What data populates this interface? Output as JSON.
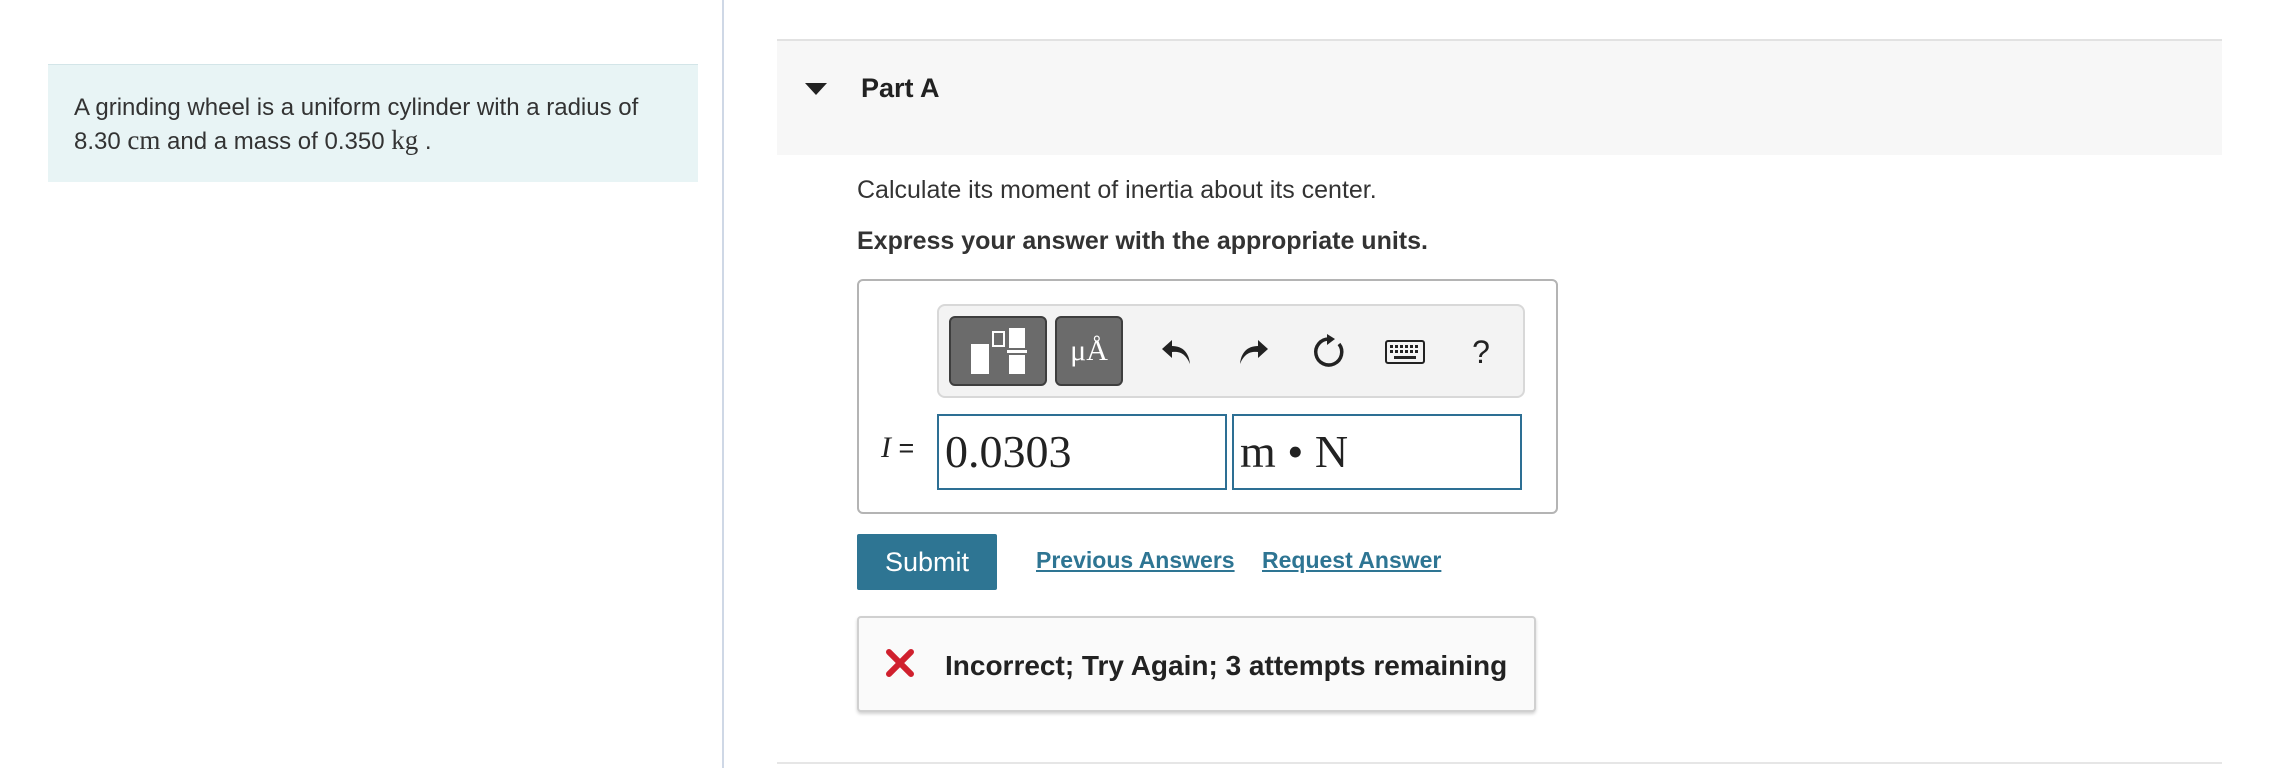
{
  "problem": {
    "text_before": "A grinding wheel is a uniform cylinder with a radius of 8.30 ",
    "radius_unit": "cm",
    "text_middle": " and a mass of 0.350 ",
    "mass_unit": "kg",
    "text_after": " ."
  },
  "part": {
    "title": "Part A",
    "question": "Calculate its moment of inertia about its center.",
    "instruction": "Express your answer with the appropriate units."
  },
  "toolbar": {
    "units_label": "μÅ",
    "help_label": "?",
    "icons": [
      "templates-icon",
      "units-icon",
      "undo-icon",
      "redo-icon",
      "reset-icon",
      "keyboard-icon",
      "help-icon"
    ]
  },
  "answer": {
    "variable": "I",
    "equals": "=",
    "value": "0.0303",
    "units": "m • N"
  },
  "actions": {
    "submit_label": "Submit",
    "previous_answers_label": "Previous Answers",
    "request_answer_label": "Request Answer"
  },
  "feedback": {
    "message": "Incorrect; Try Again; 3 attempts remaining",
    "status": "incorrect",
    "status_color": "#d0202e"
  },
  "colors": {
    "accent": "#2e7593",
    "problem_bg": "#e8f4f5",
    "input_border": "#2d6f94"
  }
}
